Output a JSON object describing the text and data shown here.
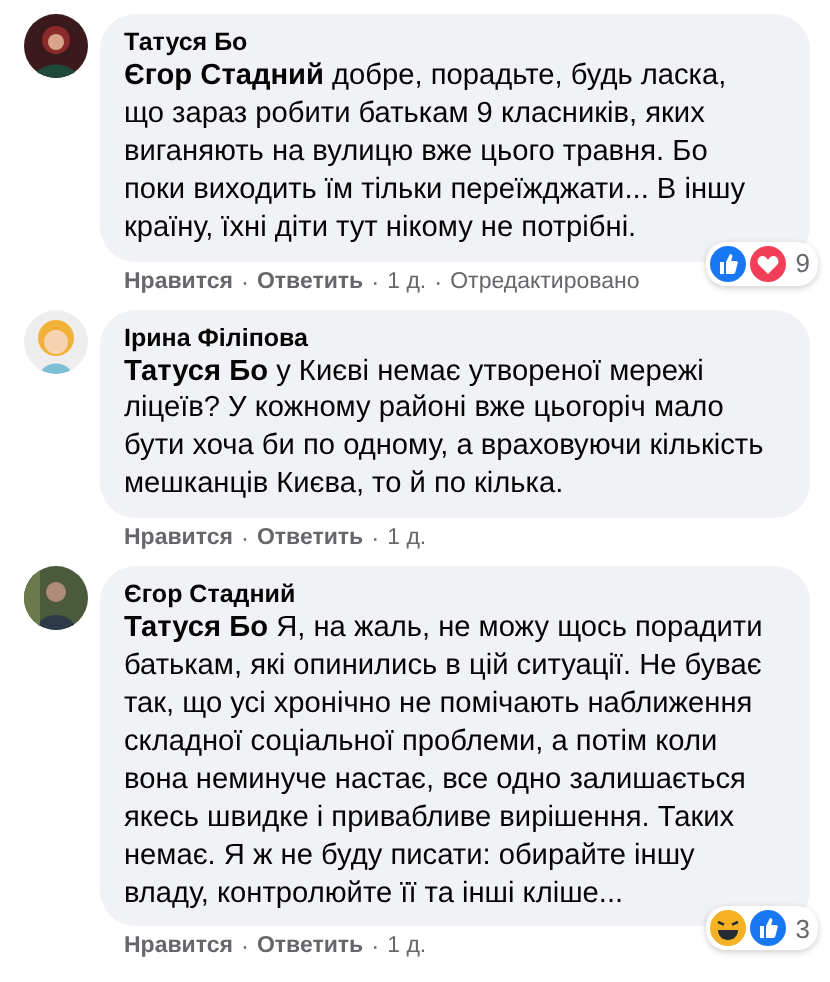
{
  "separator": "·",
  "comments": [
    {
      "author": "Татуся Бо",
      "avatar": {
        "kind": "dark"
      },
      "text": "**Єгор Стадний** добре, порадьте, будь ласка, що зараз робити батькам 9 класників, яких виганяють на вулицю вже цього травня. Бо поки виходить їм тільки переїжджати... В іншу країну, їхні діти тут нікому не потрібні.",
      "reactions": {
        "icons": [
          {
            "kind": "like"
          },
          {
            "kind": "love"
          }
        ],
        "count": "9"
      },
      "actions": [
        {
          "kind": "link",
          "label": "Нравится"
        },
        {
          "kind": "link",
          "label": "Ответить"
        },
        {
          "kind": "time",
          "label": "1 д."
        },
        {
          "kind": "note",
          "label": "Отредактировано"
        }
      ]
    },
    {
      "author": "Ірина Філіпова",
      "avatar": {
        "kind": "cartoon"
      },
      "text": "**Татуся Бо** у Києві немає утвореної мережі ліцеїв? У кожному районі вже цьогоріч мало бути хоча би по одному, а враховуючи кількість мешканців Києва, то й по кілька.",
      "actions": [
        {
          "kind": "link",
          "label": "Нравится"
        },
        {
          "kind": "link",
          "label": "Ответить"
        },
        {
          "kind": "time",
          "label": "1 д."
        }
      ]
    },
    {
      "author": "Єгор Стадний",
      "avatar": {
        "kind": "photo"
      },
      "text": "**Татуся Бо** Я, на жаль, не можу щось порадити батькам, які опинились в цій ситуації. Не буває так, що усі хронічно не помічають наближення складної соціальної проблеми, а потім коли вона неминуче настає, все одно залишається якесь швидке і привабливе вирішення. Таких немає. Я ж не буду писати: обирайте іншу владу, контролюйте її та інші кліше...",
      "reactions": {
        "icons": [
          {
            "kind": "haha"
          },
          {
            "kind": "like"
          }
        ],
        "count": "3"
      },
      "actions": [
        {
          "kind": "link",
          "label": "Нравится"
        },
        {
          "kind": "link",
          "label": "Ответить"
        },
        {
          "kind": "time",
          "label": "1 д."
        }
      ]
    }
  ]
}
